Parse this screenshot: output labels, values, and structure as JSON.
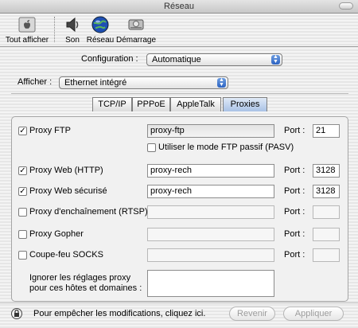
{
  "window": {
    "title": "Réseau"
  },
  "toolbar": {
    "items": [
      {
        "label": "Tout afficher",
        "icon": "apple-logo-icon"
      },
      {
        "label": "Son",
        "icon": "speaker-icon"
      },
      {
        "label": "Réseau",
        "icon": "globe-icon"
      },
      {
        "label": "Démarrage",
        "icon": "hard-drive-icon"
      }
    ]
  },
  "main": {
    "configuration_label": "Configuration :",
    "configuration_value": "Automatique",
    "show_label": "Afficher :",
    "show_value": "Ethernet intégré",
    "tabs": [
      {
        "label": "TCP/IP"
      },
      {
        "label": "PPPoE"
      },
      {
        "label": "AppleTalk"
      },
      {
        "label": "Proxies",
        "selected": true
      }
    ]
  },
  "proxies": {
    "port_label": "Port :",
    "rows": [
      {
        "label": "Proxy FTP",
        "checked": true,
        "server": "proxy-ftp",
        "port": "21"
      },
      {
        "label": "Proxy Web (HTTP)",
        "checked": true,
        "server": "proxy-rech",
        "port": "3128"
      },
      {
        "label": "Proxy Web sécurisé",
        "checked": true,
        "server": "proxy-rech",
        "port": "3128"
      },
      {
        "label": "Proxy d'enchaînement (RTSP)",
        "checked": false,
        "server": "",
        "port": ""
      },
      {
        "label": "Proxy Gopher",
        "checked": false,
        "server": "",
        "port": ""
      },
      {
        "label": "Coupe-feu SOCKS",
        "checked": false,
        "server": "",
        "port": ""
      }
    ],
    "passive_ftp_label": "Utiliser le mode FTP passif (PASV)",
    "passive_ftp_checked": false,
    "bypass_label_1": "Ignorer les réglages proxy",
    "bypass_label_2": "pour ces hôtes et domaines :",
    "bypass_value": ""
  },
  "footer": {
    "lock_text": "Pour empêcher les modifications, cliquez ici.",
    "revert_label": "Revenir",
    "apply_label": "Appliquer"
  },
  "colors": {
    "accent_blue": "#2b63c2",
    "tab_selected": "#a9c2e6"
  }
}
